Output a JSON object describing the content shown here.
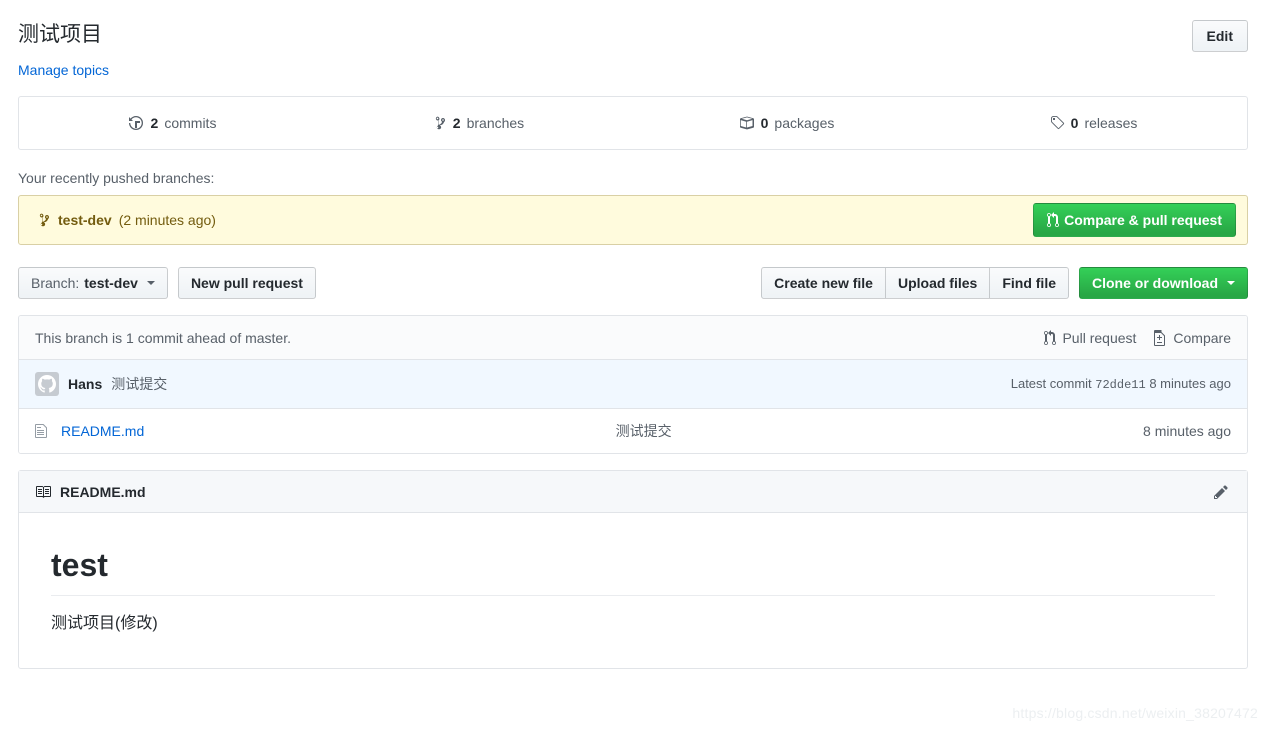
{
  "header": {
    "repo_title": "测试项目",
    "manage_topics_label": "Manage topics",
    "edit_button_label": "Edit"
  },
  "numbers_summary": [
    {
      "icon": "history-icon",
      "count": "2",
      "label": "commits"
    },
    {
      "icon": "git-branch-icon",
      "count": "2",
      "label": "branches"
    },
    {
      "icon": "package-icon",
      "count": "0",
      "label": "packages"
    },
    {
      "icon": "tag-icon",
      "count": "0",
      "label": "releases"
    }
  ],
  "recently_pushed": {
    "label": "Your recently pushed branches:",
    "branch_icon": "git-branch-icon",
    "branch_name": "test-dev",
    "time": "(2 minutes ago)",
    "compare_button_label": "Compare & pull request",
    "compare_button_icon": "git-pull-request-icon",
    "background_color": "#fffbdd",
    "border_color": "#d9d0a5",
    "text_color": "#735c0f"
  },
  "file_navigation": {
    "branch_prefix": "Branch:",
    "branch_value": "test-dev",
    "new_pull_request_label": "New pull request",
    "create_new_file_label": "Create new file",
    "upload_files_label": "Upload files",
    "find_file_label": "Find file",
    "clone_or_download_label": "Clone or download",
    "green_color": "#28a745"
  },
  "branch_infobar": {
    "status_text": "This branch is 1 commit ahead of master.",
    "pull_request_label": "Pull request",
    "pull_request_icon": "git-pull-request-icon",
    "compare_label": "Compare",
    "compare_icon": "diff-icon"
  },
  "latest_commit": {
    "avatar_icon": "github-mark-icon",
    "author": "Hans",
    "message": "测试提交",
    "meta_prefix": "Latest commit",
    "sha": "72dde11",
    "time": "8 minutes ago"
  },
  "files": [
    {
      "icon": "file-icon",
      "name": "README.md",
      "message": "测试提交",
      "age": "8 minutes ago"
    }
  ],
  "readme": {
    "icon": "book-icon",
    "title": "README.md",
    "edit_icon": "pencil-icon",
    "heading": "test",
    "paragraph": "测试项目(修改)"
  },
  "watermark": {
    "text": "https://blog.csdn.net/weixin_38207472"
  }
}
